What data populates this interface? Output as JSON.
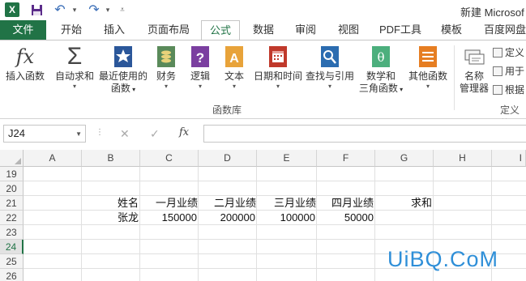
{
  "titlebar": {
    "app_logo": "X",
    "title": "新建 Microsof"
  },
  "tabs": [
    {
      "label": "文件"
    },
    {
      "label": "开始"
    },
    {
      "label": "插入"
    },
    {
      "label": "页面布局"
    },
    {
      "label": "公式"
    },
    {
      "label": "数据"
    },
    {
      "label": "审阅"
    },
    {
      "label": "视图"
    },
    {
      "label": "PDF工具"
    },
    {
      "label": "模板"
    },
    {
      "label": "百度网盘"
    }
  ],
  "ribbon": {
    "insert_function": {
      "label": "插入函数",
      "icon": "fx-icon"
    },
    "autosum": {
      "label": "自动求和",
      "icon": "sigma-icon"
    },
    "recent": {
      "line1": "最近使用的",
      "line2": "函数"
    },
    "financial": {
      "label": "财务"
    },
    "logical": {
      "label": "逻辑"
    },
    "text": {
      "label": "文本"
    },
    "datetime": {
      "label": "日期和时间"
    },
    "lookup": {
      "label": "查找与引用"
    },
    "math": {
      "line1": "数学和",
      "line2": "三角函数"
    },
    "more": {
      "label": "其他函数"
    },
    "name_manager": {
      "line1": "名称",
      "line2": "管理器"
    },
    "define_name": "定义",
    "use_in_formula": "用于",
    "create_from_selection": "根据",
    "group_label": "函数库",
    "defined_names_label": "定义的"
  },
  "formula_bar": {
    "name_box": "J24",
    "cancel": "✕",
    "enter": "✓",
    "fx": "fx",
    "value": ""
  },
  "grid": {
    "columns": [
      "A",
      "B",
      "C",
      "D",
      "E",
      "F",
      "G",
      "H",
      "I"
    ],
    "rows": [
      "19",
      "20",
      "21",
      "22",
      "23",
      "24",
      "25",
      "26"
    ],
    "row21": {
      "B": "姓名",
      "C": "一月业绩",
      "D": "二月业绩",
      "E": "三月业绩",
      "F": "四月业绩",
      "G": "求和"
    },
    "row22": {
      "B": "张龙",
      "C": "150000",
      "D": "200000",
      "E": "100000",
      "F": "50000"
    }
  },
  "watermark": "UiBQ.CoM",
  "colors": {
    "excel_green": "#217346",
    "watermark_blue": "#2f8fd8"
  }
}
